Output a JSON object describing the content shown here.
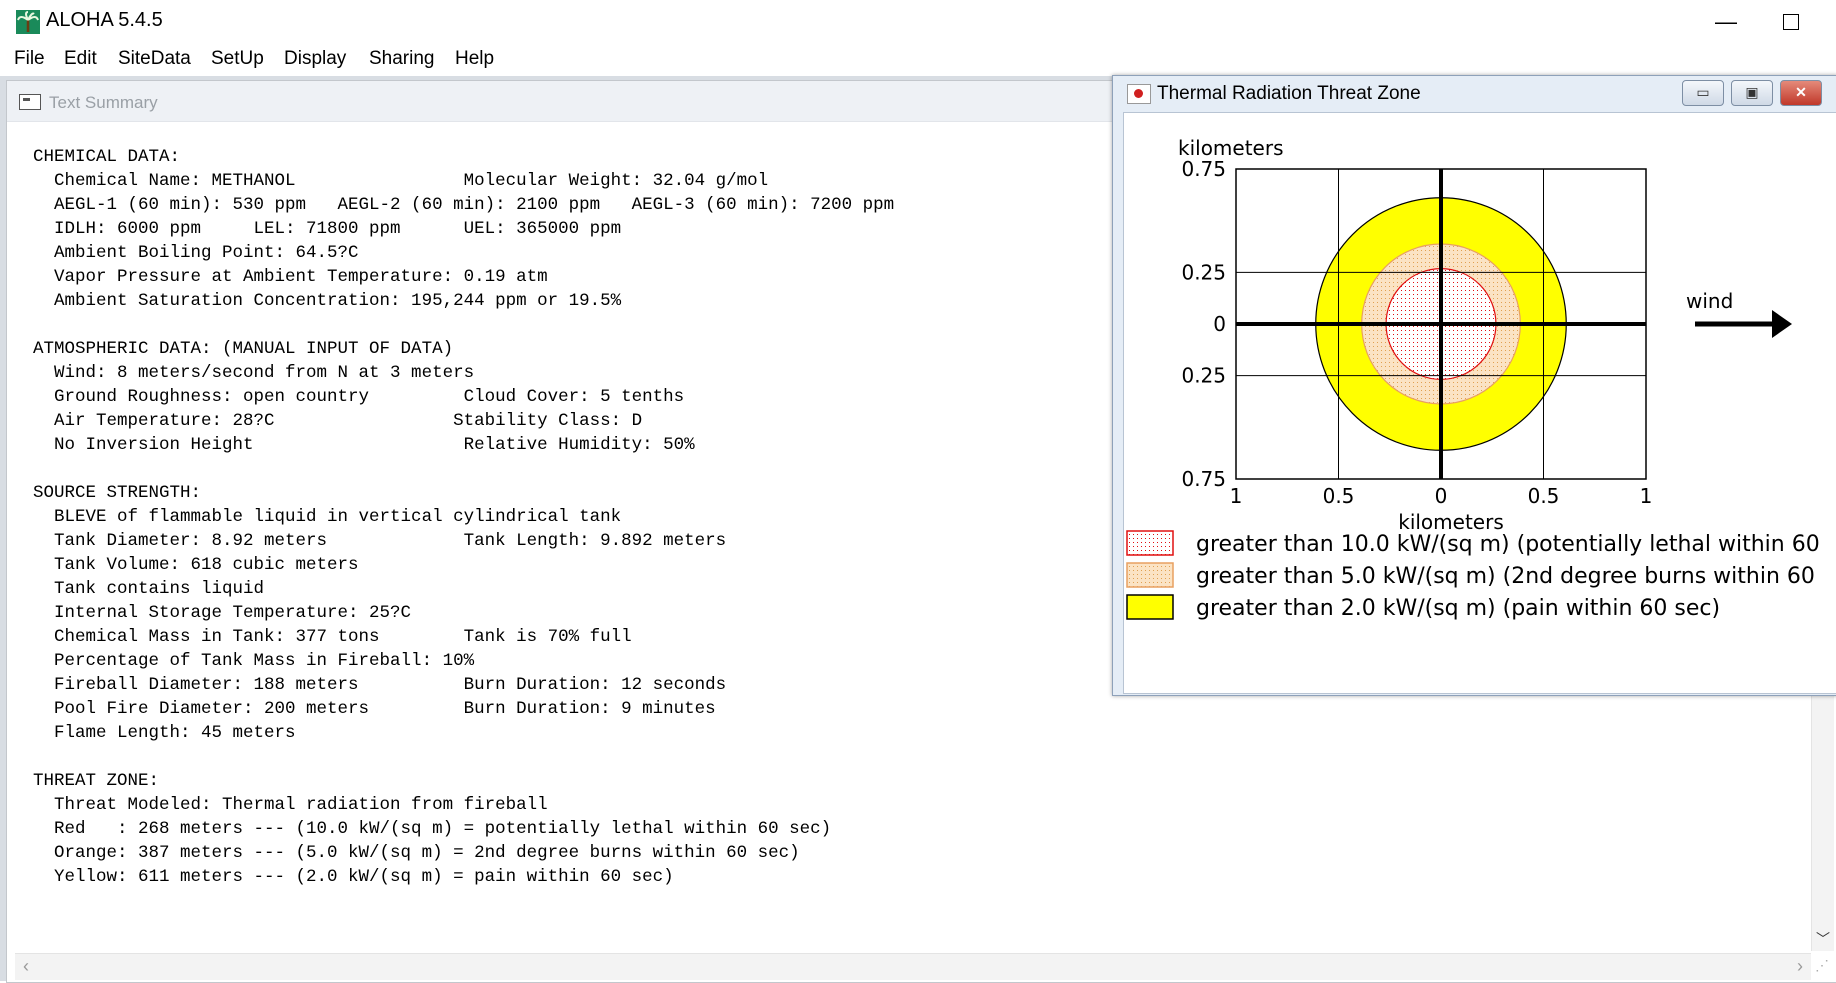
{
  "app": {
    "title": "ALOHA 5.4.5",
    "minimize_glyph": "—"
  },
  "menu": [
    "File",
    "Edit",
    "SiteData",
    "SetUp",
    "Display",
    "Sharing",
    "Help"
  ],
  "text_summary": {
    "title": "Text Summary",
    "lines": [
      "CHEMICAL DATA:",
      "  Chemical Name: METHANOL                Molecular Weight: 32.04 g/mol",
      "  AEGL-1 (60 min): 530 ppm   AEGL-2 (60 min): 2100 ppm   AEGL-3 (60 min): 7200 ppm",
      "  IDLH: 6000 ppm     LEL: 71800 ppm      UEL: 365000 ppm",
      "  Ambient Boiling Point: 64.5?C",
      "  Vapor Pressure at Ambient Temperature: 0.19 atm",
      "  Ambient Saturation Concentration: 195,244 ppm or 19.5%",
      "",
      "ATMOSPHERIC DATA: (MANUAL INPUT OF DATA)",
      "  Wind: 8 meters/second from N at 3 meters",
      "  Ground Roughness: open country         Cloud Cover: 5 tenths",
      "  Air Temperature: 28?C                 Stability Class: D",
      "  No Inversion Height                    Relative Humidity: 50%",
      "",
      "SOURCE STRENGTH:",
      "  BLEVE of flammable liquid in vertical cylindrical tank",
      "  Tank Diameter: 8.92 meters             Tank Length: 9.892 meters",
      "  Tank Volume: 618 cubic meters",
      "  Tank contains liquid",
      "  Internal Storage Temperature: 25?C",
      "  Chemical Mass in Tank: 377 tons        Tank is 70% full",
      "  Percentage of Tank Mass in Fireball: 10%",
      "  Fireball Diameter: 188 meters          Burn Duration: 12 seconds",
      "  Pool Fire Diameter: 200 meters         Burn Duration: 9 minutes",
      "  Flame Length: 45 meters",
      "",
      "THREAT ZONE:",
      "  Threat Modeled: Thermal radiation from fireball",
      "  Red   : 268 meters --- (10.0 kW/(sq m) = potentially lethal within 60 sec)",
      "  Orange: 387 meters --- (5.0 kW/(sq m) = 2nd degree burns within 60 sec)",
      "  Yellow: 611 meters --- (2.0 kW/(sq m) = pain within 60 sec)"
    ]
  },
  "threat_zone": {
    "title": "Thermal Radiation Threat Zone",
    "buttons": {
      "minimize": "▭",
      "restore": "▣",
      "close": "✕"
    },
    "y_axis_title": "kilometers",
    "x_axis_title": "kilometers",
    "y_ticks": [
      {
        "label": "0.75",
        "value": 0.75
      },
      {
        "label": "0.25",
        "value": 0.25
      },
      {
        "label": "0",
        "value": 0
      },
      {
        "label": "0.25",
        "value": -0.25
      },
      {
        "label": "0.75",
        "value": -0.75
      }
    ],
    "x_ticks": [
      {
        "label": "1",
        "value": -1
      },
      {
        "label": "0.5",
        "value": -0.5
      },
      {
        "label": "0",
        "value": 0
      },
      {
        "label": "0.5",
        "value": 0.5
      },
      {
        "label": "1",
        "value": 1
      }
    ],
    "x_range": [
      -1,
      1
    ],
    "y_range": [
      -0.75,
      0.75
    ],
    "wind_label": "wind",
    "zones": [
      {
        "name": "yellow",
        "radius_km": 0.611,
        "fill": "#ffff00",
        "stroke": "#000000",
        "pattern": "solid"
      },
      {
        "name": "orange",
        "radius_km": 0.387,
        "fill": "#f8d6a8",
        "stroke": "#e8a060",
        "pattern": "dots"
      },
      {
        "name": "red",
        "radius_km": 0.268,
        "fill": "#ffffff",
        "stroke": "#e01010",
        "pattern": "dots"
      }
    ],
    "legend": [
      {
        "label": "greater than 10.0 kW/(sq m) (potentially lethal within 60",
        "fill": "#ffffff",
        "stroke": "#e01010",
        "pattern": "dots",
        "dot": "#e01010"
      },
      {
        "label": "greater than 5.0 kW/(sq m) (2nd degree burns within 60",
        "fill": "#fbe3c4",
        "stroke": "#e8a060",
        "pattern": "dots",
        "dot": "#e0a050"
      },
      {
        "label": "greater than 2.0 kW/(sq m) (pain within 60 sec)",
        "fill": "#ffff00",
        "stroke": "#000000",
        "pattern": "solid",
        "dot": ""
      }
    ]
  }
}
